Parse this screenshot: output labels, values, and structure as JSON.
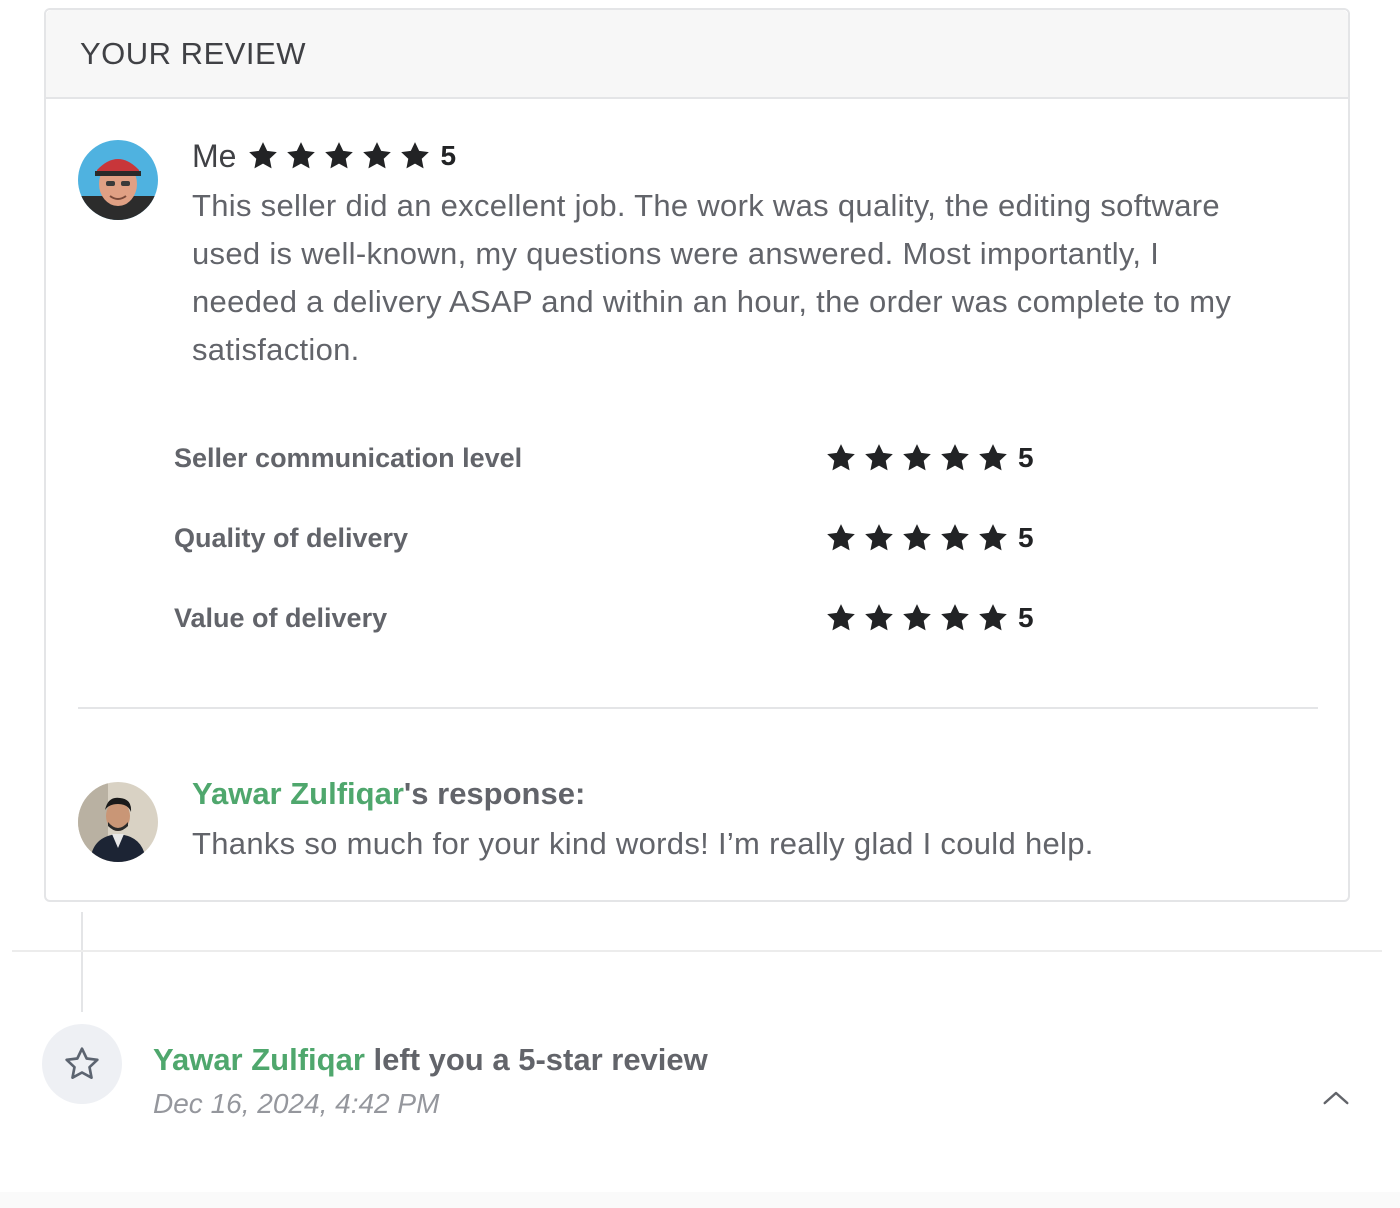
{
  "card": {
    "header_title": "YOUR REVIEW"
  },
  "buyer_review": {
    "name": "Me",
    "rating": "5",
    "text": "This seller did an excellent job. The work was quality, the editing software used is well-known, my questions were answered. Most importantly, I needed a delivery ASAP and within an hour, the order was complete to my satisfaction."
  },
  "criteria": [
    {
      "label": "Seller communication level",
      "rating": "5"
    },
    {
      "label": "Quality of delivery",
      "rating": "5"
    },
    {
      "label": "Value of delivery",
      "rating": "5"
    }
  ],
  "seller_response": {
    "seller_name": "Yawar Zulfiqar",
    "title_suffix": "'s response:",
    "text": "Thanks so much for your kind words! I’m really glad I could help."
  },
  "event": {
    "actor": "Yawar Zulfiqar",
    "text": " left you a 5-star review",
    "date": "Dec 16, 2024, 4:42 PM"
  },
  "icons": {
    "star": "star-icon",
    "event": "star-outline-icon",
    "collapse": "chevron-up-icon"
  },
  "colors": {
    "accent_green": "#4fa76d",
    "star": "#222325",
    "text": "#62646a"
  }
}
